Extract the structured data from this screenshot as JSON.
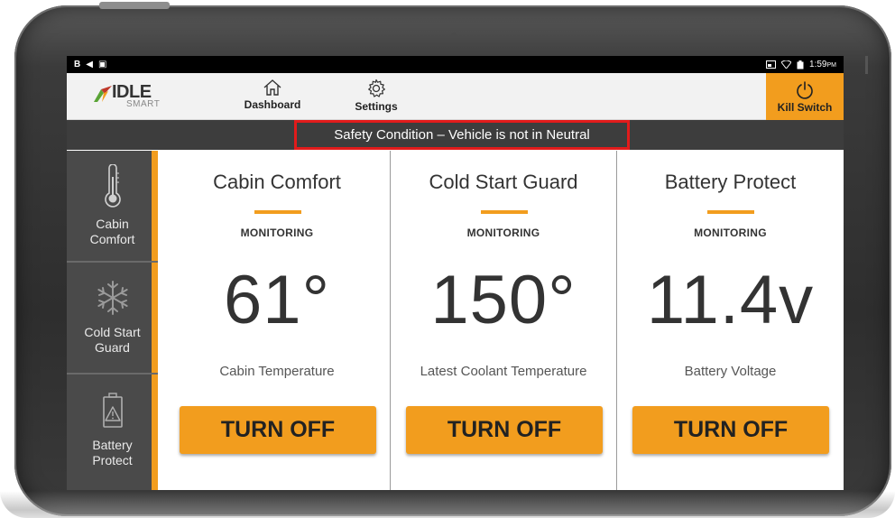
{
  "status_bar": {
    "left_glyphs": [
      "B",
      "◀",
      "▣"
    ],
    "time": "1:59",
    "ampm": "PM"
  },
  "header": {
    "logo_main": "IDLE",
    "logo_sub": "SMART",
    "nav": [
      {
        "label": "Dashboard",
        "icon": "home-icon"
      },
      {
        "label": "Settings",
        "icon": "gear-icon"
      }
    ],
    "kill_switch": {
      "label": "Kill Switch",
      "icon": "power-icon"
    }
  },
  "alert": {
    "message": "Safety Condition – Vehicle is not in Neutral"
  },
  "sidebar": {
    "items": [
      {
        "label": "Cabin Comfort",
        "icon": "thermometer-icon"
      },
      {
        "label": "Cold Start Guard",
        "icon": "snowflake-icon"
      },
      {
        "label": "Battery Protect",
        "icon": "battery-warning-icon"
      }
    ]
  },
  "cards": [
    {
      "title": "Cabin Comfort",
      "status": "MONITORING",
      "value": "61°",
      "subtitle": "Cabin Temperature",
      "button": "TURN OFF"
    },
    {
      "title": "Cold Start Guard",
      "status": "MONITORING",
      "value": "150°",
      "subtitle": "Latest Coolant Temperature",
      "button": "TURN OFF"
    },
    {
      "title": "Battery Protect",
      "status": "MONITORING",
      "value": "11.4v",
      "subtitle": "Battery Voltage",
      "button": "TURN OFF"
    }
  ],
  "colors": {
    "accent": "#f29d1e",
    "alert_border": "#e21b1b",
    "sidebar_bg": "#4a4a4a",
    "alert_bg": "#3d3d3d"
  }
}
